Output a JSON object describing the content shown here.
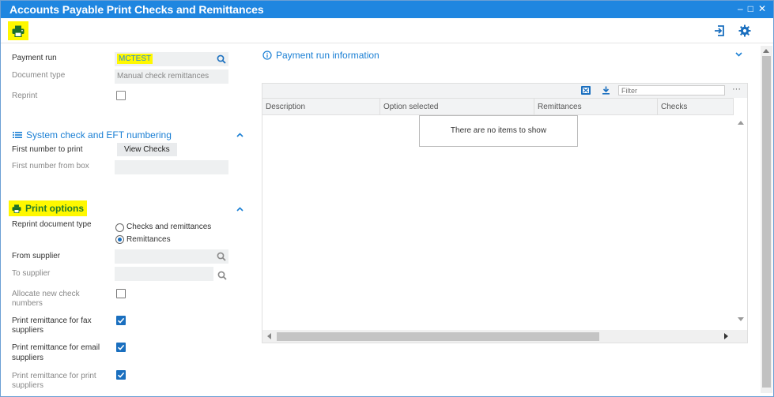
{
  "window": {
    "title": "Accounts Payable Print Checks and Remittances",
    "controls": [
      "–",
      "□",
      "✕"
    ]
  },
  "colors": {
    "titlebar": "#1f86e0",
    "accent": "#1a7fd4",
    "highlight": "#fff800",
    "checkbox_checked": "#1a6fbf"
  },
  "toolbar": {
    "print_icon": "printer-icon",
    "right_icons": [
      "export-icon",
      "gear-icon"
    ]
  },
  "form": {
    "payment_run": {
      "label": "Payment run",
      "value": "MCTEST"
    },
    "document_type": {
      "label": "Document type",
      "value": "Manual check remittances"
    },
    "reprint": {
      "label": "Reprint",
      "checked": false
    }
  },
  "numbering": {
    "title": "System check and EFT numbering",
    "first_number": {
      "label": "First number to print",
      "button": "View Checks"
    },
    "first_from_box": {
      "label": "First number from box",
      "value": ""
    }
  },
  "print_options": {
    "title": "Print options",
    "reprint_doc_type": {
      "label": "Reprint document type",
      "options": [
        "Checks and remittances",
        "Remittances"
      ],
      "selected": "Remittances"
    },
    "from_supplier": {
      "label": "From supplier",
      "value": ""
    },
    "to_supplier": {
      "label": "To supplier",
      "value": ""
    },
    "allocate": {
      "label_line1": "Allocate new check",
      "label_line2": "numbers",
      "checked": false
    },
    "fax": {
      "label_line1": "Print remittance for fax",
      "label_line2": "suppliers",
      "checked": true
    },
    "email": {
      "label_line1": "Print remittance for email",
      "label_line2": "suppliers",
      "checked": true
    },
    "print": {
      "label_line1": "Print remittance for print",
      "label_line2": "suppliers",
      "checked": true
    }
  },
  "payment_info": {
    "title": "Payment run information",
    "filter_placeholder": "Filter",
    "columns": [
      "Description",
      "Option selected",
      "Remittances",
      "Checks"
    ],
    "empty_text": "There are no items to show",
    "more": "···"
  }
}
